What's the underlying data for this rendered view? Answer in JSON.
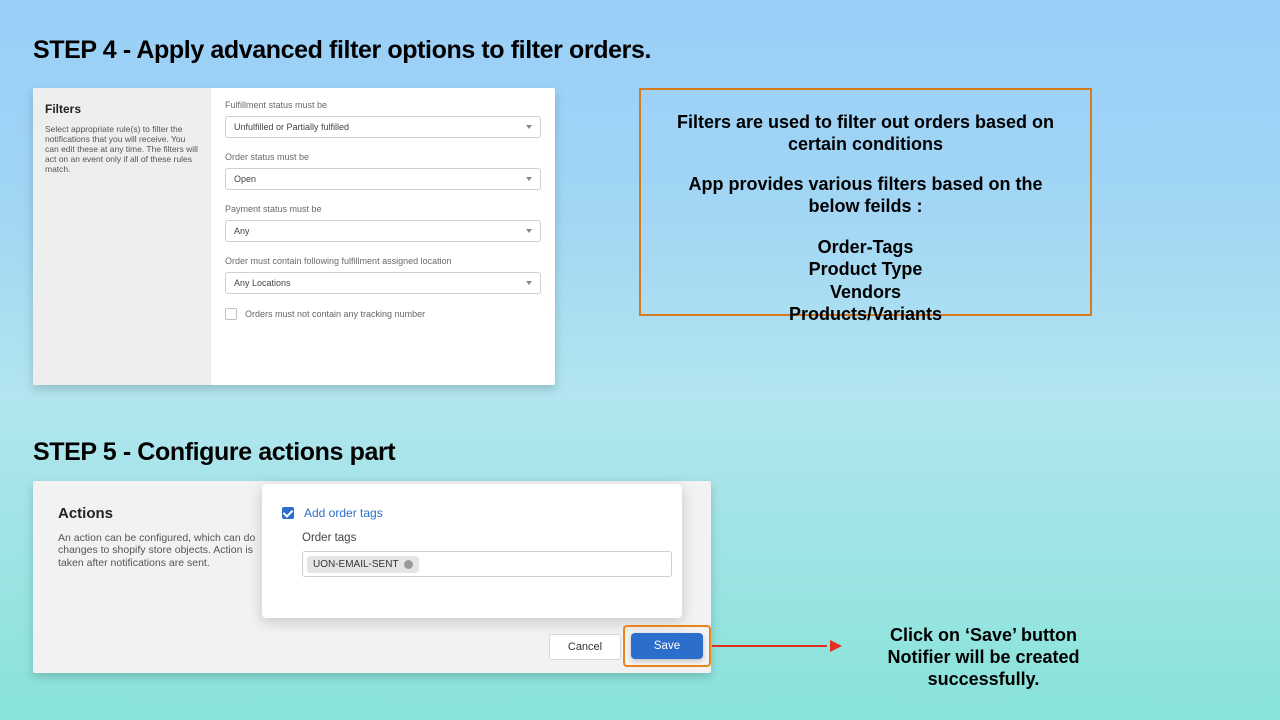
{
  "step4": {
    "heading": "STEP 4 - Apply advanced filter options to filter orders."
  },
  "filters_panel": {
    "title": "Filters",
    "subtitle": "Select appropriate rule(s) to filter the notifications that you will receive. You can edit these at any time. The filters will act on an event only if all of these rules match.",
    "fields": {
      "fulfillment": {
        "label": "Fulfillment status must be",
        "value": "Unfulfilled or Partially fulfilled"
      },
      "order": {
        "label": "Order status must be",
        "value": "Open"
      },
      "payment": {
        "label": "Payment status must be",
        "value": "Any"
      },
      "location": {
        "label": "Order must contain following fulfillment assigned location",
        "value": "Any Locations"
      }
    },
    "tracking_checkbox": {
      "label": "Orders must not contain any tracking number",
      "checked": false
    }
  },
  "callout": {
    "line1": "Filters are used to filter out orders based on certain conditions",
    "line2": "App provides various filters based on the below feilds :",
    "items": [
      "Order-Tags",
      "Product Type",
      "Vendors",
      "Products/Variants"
    ]
  },
  "step5": {
    "heading": "STEP 5 - Configure actions part"
  },
  "actions_panel": {
    "title": "Actions",
    "subtitle": "An action can be configured, which can do changes to shopify store objects. Action is taken after notifications are sent."
  },
  "actions_card": {
    "checkbox_label": "Add order tags",
    "ordertags_label": "Order tags",
    "tag_value": "UON-EMAIL-SENT"
  },
  "buttons": {
    "cancel": "Cancel",
    "save": "Save"
  },
  "save_caption": {
    "l1": "Click on ‘Save’ button",
    "l2": "Notifier will be created successfully."
  },
  "colors": {
    "orange": "#e8851b",
    "blue": "#2c6ecb",
    "red": "#e22f1f"
  }
}
